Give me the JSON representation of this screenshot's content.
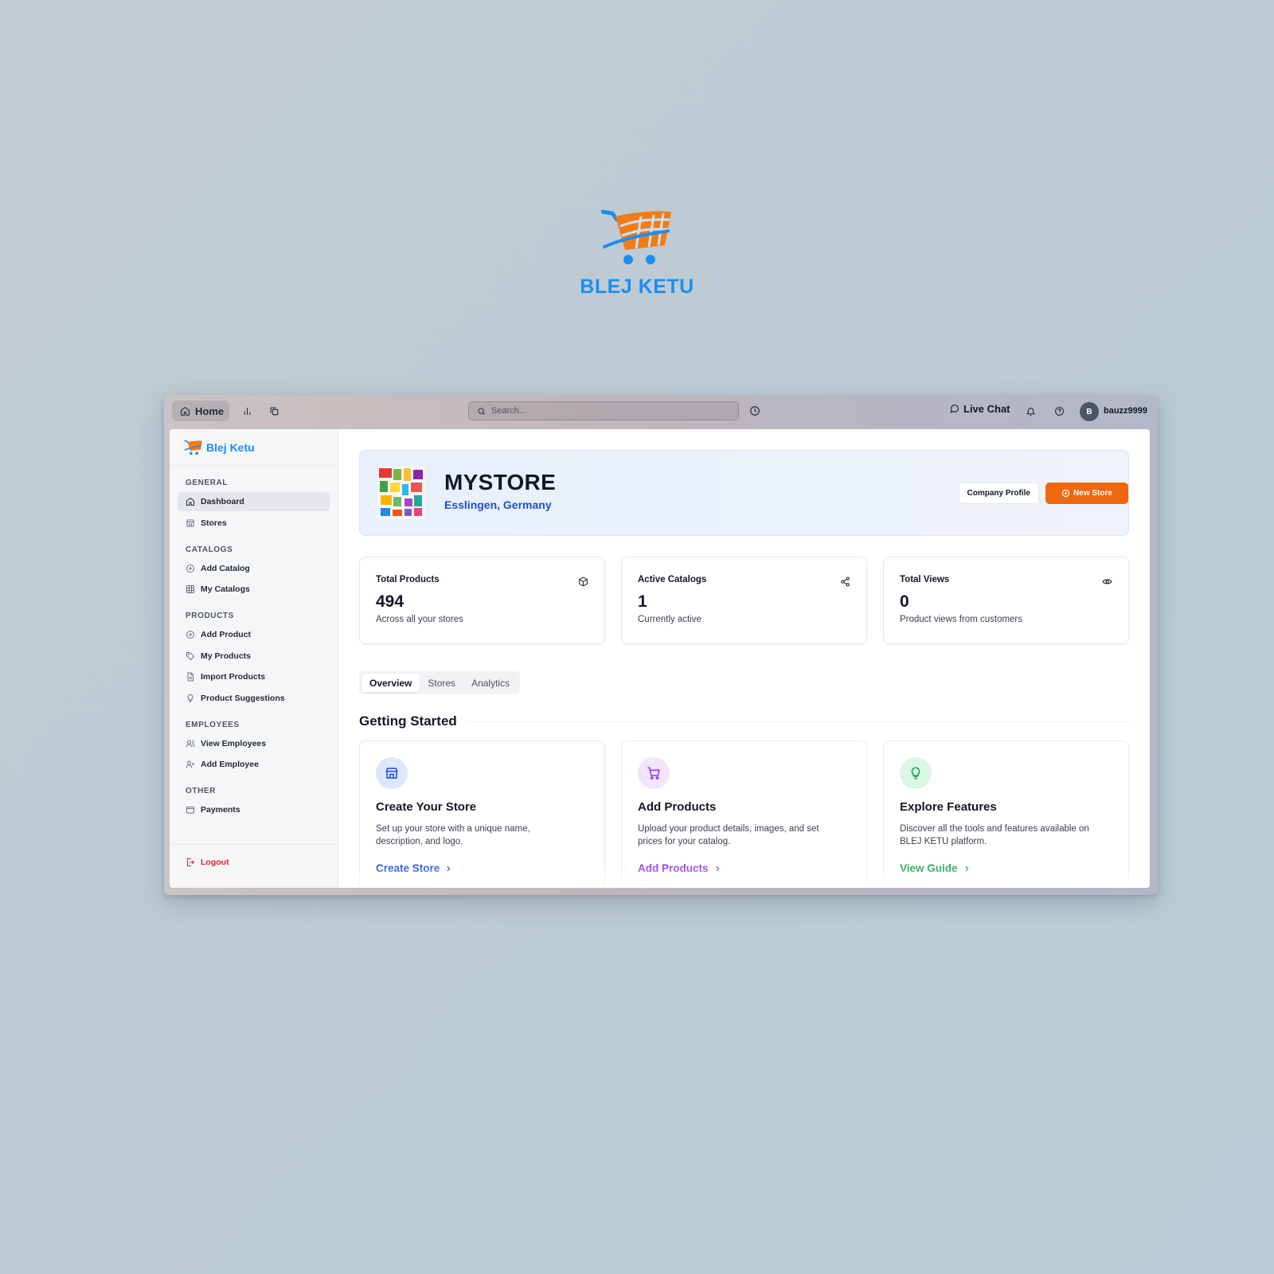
{
  "brand": {
    "name": "BLEJ KETU",
    "colors": {
      "blue": "#1a8ff2",
      "orange": "#f47b16"
    }
  },
  "topbar": {
    "home_label": "Home",
    "search_placeholder": "Search...",
    "live_chat_label": "Live Chat",
    "avatar_initial": "B",
    "username": "bauzz9999",
    "icons": [
      "home-icon",
      "bar-chart-icon",
      "copy-icon",
      "search-icon",
      "history-icon",
      "chat-icon",
      "bell-icon",
      "help-icon"
    ]
  },
  "sidebar": {
    "logo_text": "Blej Ketu",
    "sections": [
      {
        "title": "GENERAL",
        "items": [
          {
            "label": "Dashboard",
            "icon": "home-icon",
            "active": true
          },
          {
            "label": "Stores",
            "icon": "store-icon"
          }
        ]
      },
      {
        "title": "CATALOGS",
        "items": [
          {
            "label": "Add Catalog",
            "icon": "plus-circle-icon"
          },
          {
            "label": "My Catalogs",
            "icon": "grid-icon"
          }
        ]
      },
      {
        "title": "PRODUCTS",
        "items": [
          {
            "label": "Add Product",
            "icon": "plus-circle-icon"
          },
          {
            "label": "My Products",
            "icon": "tag-icon"
          },
          {
            "label": "Import Products",
            "icon": "file-icon"
          },
          {
            "label": "Product Suggestions",
            "icon": "lightbulb-icon"
          }
        ]
      },
      {
        "title": "EMPLOYEES",
        "items": [
          {
            "label": "View Employees",
            "icon": "users-icon"
          },
          {
            "label": "Add Employee",
            "icon": "user-plus-icon"
          }
        ]
      },
      {
        "title": "OTHER",
        "items": [
          {
            "label": "Payments",
            "icon": "wallet-icon"
          }
        ]
      }
    ],
    "logout_label": "Logout"
  },
  "store": {
    "name": "MYSTORE",
    "location": "Esslingen, Germany",
    "company_profile_label": "Company Profile",
    "new_store_label": "New Store",
    "accent": "#f0670f"
  },
  "stats": [
    {
      "label": "Total Products",
      "value": "494",
      "sub": "Across all your stores",
      "icon": "box-icon"
    },
    {
      "label": "Active Catalogs",
      "value": "1",
      "sub": "Currently active",
      "icon": "share-icon"
    },
    {
      "label": "Total Views",
      "value": "0",
      "sub": "Product views from customers",
      "icon": "eye-icon"
    }
  ],
  "tabs": [
    {
      "label": "Overview",
      "active": true
    },
    {
      "label": "Stores"
    },
    {
      "label": "Analytics"
    }
  ],
  "getting_started": {
    "title": "Getting Started",
    "cards": [
      {
        "title": "Create Your Store",
        "desc": "Set up your store with a unique name, description, and logo.",
        "link": "Create Store",
        "icon": "store-icon",
        "color": "#1d4ed8",
        "bg": "#dbe7fb"
      },
      {
        "title": "Add Products",
        "desc": "Upload your product details, images, and set prices for your catalog.",
        "link": "Add Products",
        "icon": "cart-icon",
        "color": "#9333ea",
        "bg": "#f1e4fb"
      },
      {
        "title": "Explore Features",
        "desc": "Discover all the tools and features available on BLEJ KETU platform.",
        "link": "View Guide",
        "icon": "lightbulb-icon",
        "color": "#16a34a",
        "bg": "#dcf5e5"
      }
    ]
  }
}
